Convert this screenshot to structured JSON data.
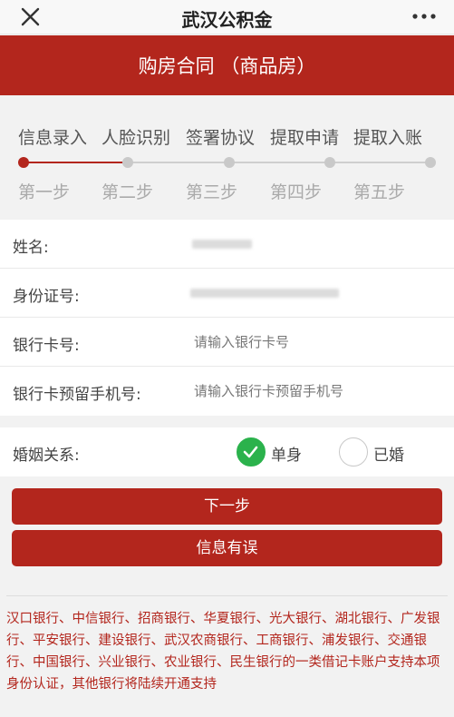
{
  "header": {
    "close_icon": "close-icon",
    "title": "武汉公积金",
    "more_icon": "more-dots-icon"
  },
  "banner": {
    "title": "购房合同 （商品房）"
  },
  "steps": [
    {
      "label": "信息录入",
      "sub": "第一步",
      "active": true
    },
    {
      "label": "人脸识别",
      "sub": "第二步",
      "active": false
    },
    {
      "label": "签署协议",
      "sub": "第三步",
      "active": false
    },
    {
      "label": "提取申请",
      "sub": "第四步",
      "active": false
    },
    {
      "label": "提取入账",
      "sub": "第五步",
      "active": false
    }
  ],
  "form": {
    "name_label": "姓名:",
    "id_label": "身份证号:",
    "card_label": "银行卡号:",
    "card_placeholder": "请输入银行卡号",
    "phone_label": "银行卡预留手机号:",
    "phone_placeholder": "请输入银行卡预留手机号"
  },
  "marital": {
    "label": "婚姻关系:",
    "options": [
      {
        "label": "单身",
        "checked": true
      },
      {
        "label": "已婚",
        "checked": false
      }
    ]
  },
  "buttons": {
    "next": "下一步",
    "error": "信息有误"
  },
  "notice": "汉口银行、中信银行、招商银行、华夏银行、光大银行、湖北银行、广发银行、平安银行、建设银行、武汉农商银行、工商银行、浦发银行、交通银行、中国银行、兴业银行、农业银行、民生银行的一类借记卡账户支持本项身份认证，其他银行将陆续开通支持",
  "colors": {
    "brand": "#b3261d",
    "check": "#2bb24c"
  }
}
